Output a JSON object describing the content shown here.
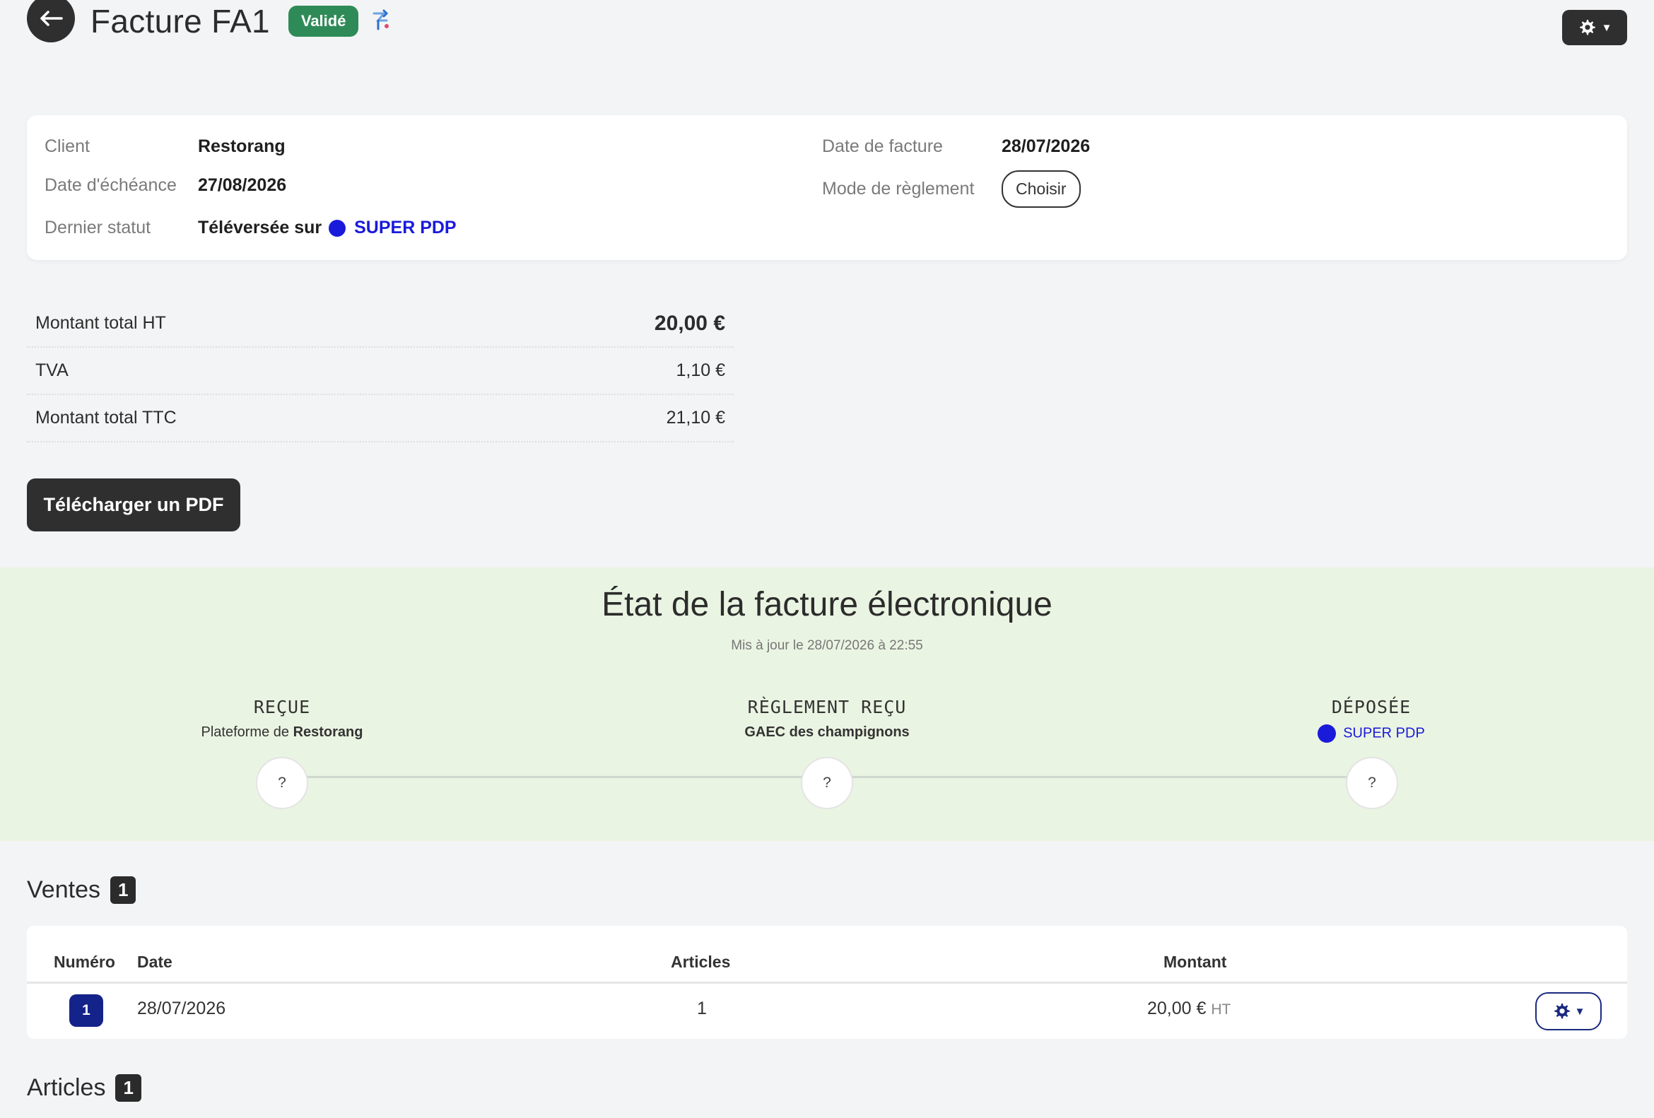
{
  "header": {
    "title": "Facture FA1",
    "status": "Validé"
  },
  "info": {
    "client_label": "Client",
    "client_value": "Restorang",
    "due_label": "Date d'échéance",
    "due_value": "27/08/2026",
    "last_status_label": "Dernier statut",
    "last_status_text": "Téléversée sur",
    "last_status_platform": "SUPER PDP",
    "invoice_date_label": "Date de facture",
    "invoice_date_value": "28/07/2026",
    "payment_mode_label": "Mode de règlement",
    "payment_mode_button": "Choisir"
  },
  "totals": {
    "ht_label": "Montant total HT",
    "ht_value": "20,00 €",
    "tva_label": "TVA",
    "tva_value": "1,10 €",
    "ttc_label": "Montant total TTC",
    "ttc_value": "21,10 €"
  },
  "download_pdf": "Télécharger un PDF",
  "einvoice": {
    "title": "État de la facture électronique",
    "updated": "Mis à jour le 28/07/2026 à 22:55",
    "steps": [
      {
        "title": "REÇUE",
        "sub_prefix": "Plateforme de",
        "sub_bold": "Restorang",
        "circle": "?"
      },
      {
        "title": "RÈGLEMENT REÇU",
        "sub_bold": "GAEC des champignons",
        "circle": "?"
      },
      {
        "title": "DÉPOSÉE",
        "sub_link": "SUPER PDP",
        "circle": "?"
      }
    ]
  },
  "ventes": {
    "title": "Ventes",
    "count": "1",
    "columns": [
      "Numéro",
      "Date",
      "Articles",
      "Montant"
    ],
    "rows": [
      {
        "numero": "1",
        "date": "28/07/2026",
        "articles": "1",
        "montant": "20,00 €",
        "suffix": "HT"
      }
    ]
  },
  "articles": {
    "title": "Articles",
    "count": "1"
  },
  "colors": {
    "accent_dark": "#2f2f2f",
    "status_green": "#2e8b57",
    "pdp_blue": "#1a1adb",
    "einvoice_bg": "#eaf4e2",
    "badge_navy": "#14238a"
  }
}
